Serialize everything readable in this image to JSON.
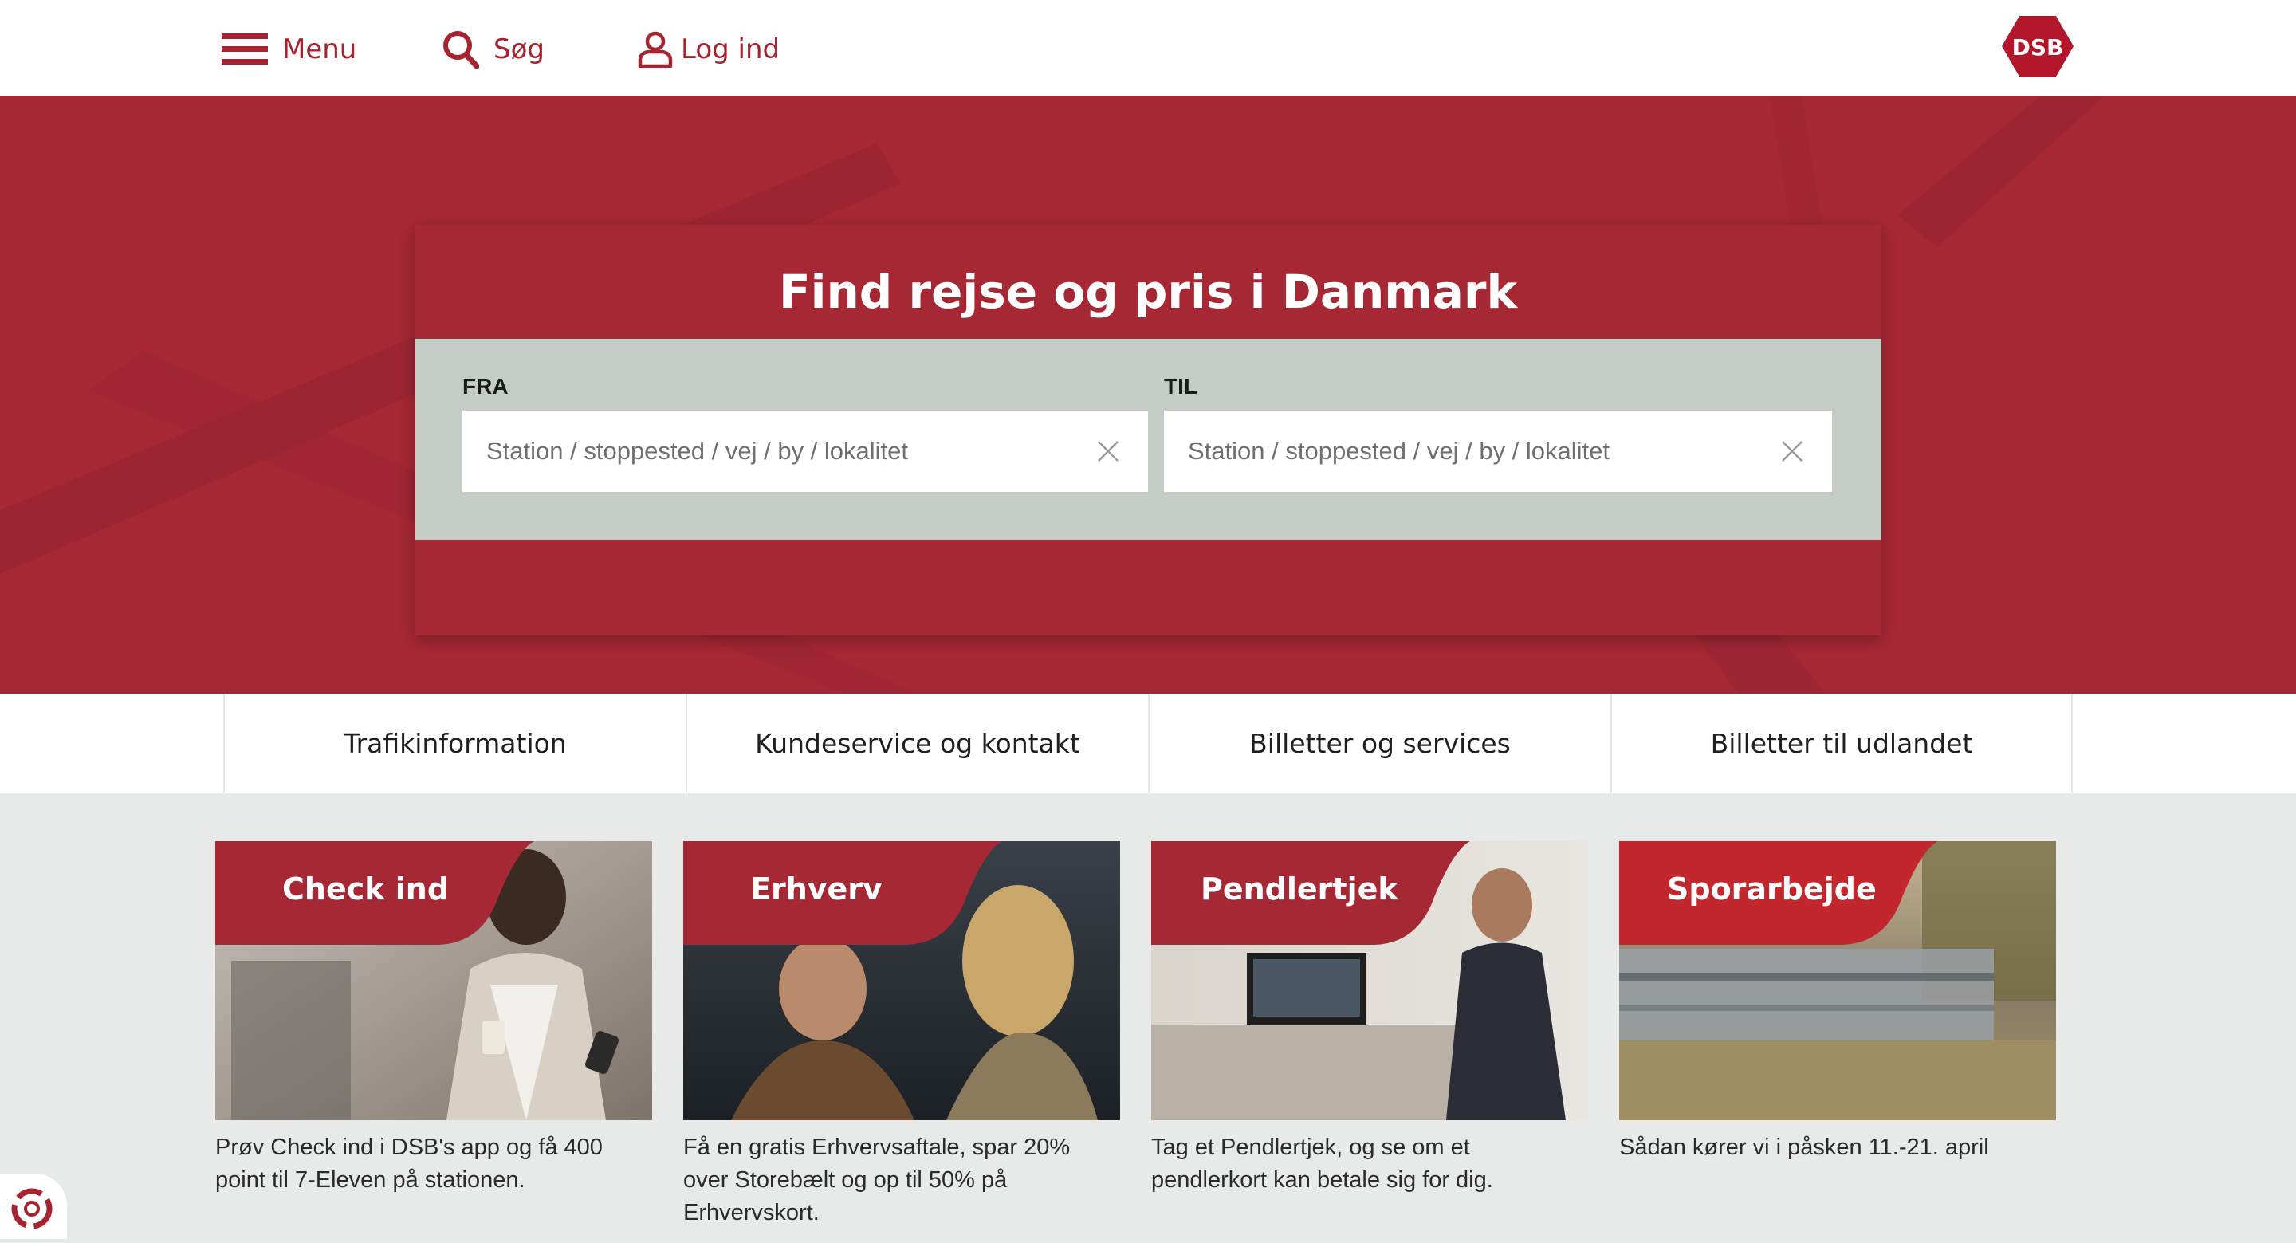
{
  "header": {
    "menu_label": "Menu",
    "search_label": "Søg",
    "login_label": "Log ind",
    "logo_text": "DSB",
    "brand_color": "#a6232f"
  },
  "hero": {
    "title": "Find rejse og pris i Danmark",
    "from": {
      "label": "FRA",
      "placeholder": "Station / stoppested / vej / by / lokalitet",
      "value": ""
    },
    "to": {
      "label": "TIL",
      "placeholder": "Station / stoppested / vej / by / lokalitet",
      "value": ""
    }
  },
  "quicklinks": [
    "Trafikinformation",
    "Kundeservice og kontakt",
    "Billetter og services",
    "Billetter til udlandet"
  ],
  "promos": [
    {
      "title": "Check ind",
      "description": "Prøv Check ind i DSB's app og få 400 point til 7-Eleven på stationen."
    },
    {
      "title": "Erhverv",
      "description": "Få en gratis Erhvervsaftale, spar 20% over Storebælt og op til 50% på Erhvervskort."
    },
    {
      "title": "Pendlertjek",
      "description": "Tag et Pendlertjek, og se om et pendlerkort kan betale sig for dig."
    },
    {
      "title": "Sporarbejde",
      "description": "Sådan kører vi i påsken 11.-21. april"
    }
  ],
  "icons": [
    "hamburger-icon",
    "search-icon",
    "user-icon",
    "close-icon",
    "cookie-settings-icon"
  ]
}
